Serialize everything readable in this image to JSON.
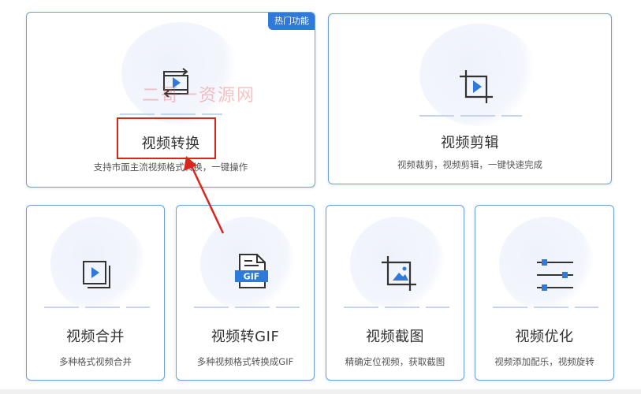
{
  "colors": {
    "accent": "#2f7ad8",
    "border": "#6f9fd8",
    "annotation": "#d9261c"
  },
  "hot_badge": "热门功能",
  "watermark": "二哥一资源网",
  "cards": {
    "video_convert": {
      "title": "视频转换",
      "desc": "支持市面主流视频格式转换，一键操作",
      "icon": "video-convert-icon"
    },
    "video_edit": {
      "title": "视频剪辑",
      "desc": "视频裁剪，视频剪辑，一键快速完成",
      "icon": "crop-icon"
    },
    "video_merge": {
      "title": "视频合并",
      "desc": "多种格式视频合并",
      "icon": "video-merge-icon"
    },
    "video_gif": {
      "title": "视频转GIF",
      "desc": "多种视频格式转换成GIF",
      "icon": "gif-file-icon",
      "icon_text": "GIF"
    },
    "video_screenshot": {
      "title": "视频截图",
      "desc": "精确定位视频，获取截图",
      "icon": "screenshot-crop-icon"
    },
    "video_optimize": {
      "title": "视频优化",
      "desc": "视频添加配乐，视频旋转",
      "icon": "sliders-icon"
    }
  }
}
